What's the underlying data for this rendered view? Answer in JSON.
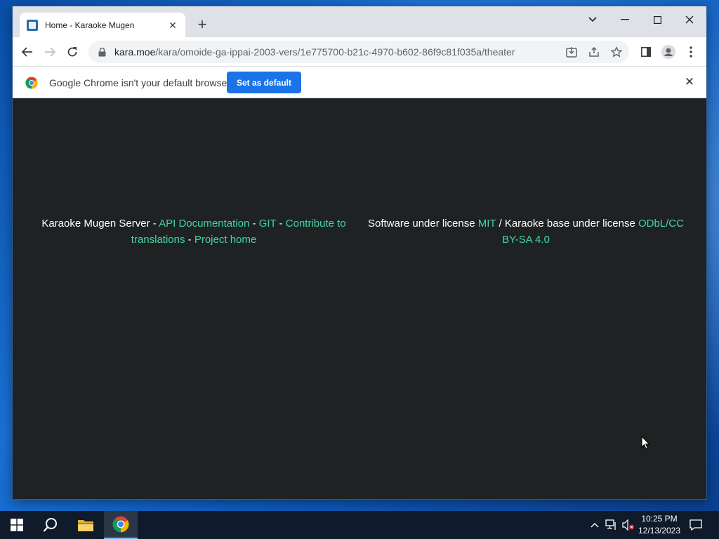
{
  "browser": {
    "tab": {
      "title": "Home - Karaoke Mugen"
    },
    "address_bar": {
      "host": "kara.moe",
      "path": "/kara/omoide-ga-ippai-2003-vers/1e775700-b21c-4970-b602-86f9c81f035a/theater"
    },
    "infobar": {
      "message": "Google Chrome isn't your default browser",
      "button_label": "Set as default"
    }
  },
  "page": {
    "left_footer": {
      "prefix": "Karaoke Mugen Server - ",
      "link_api": "API Documentation",
      "sep1": " - ",
      "link_git": "GIT",
      "sep2": " - ",
      "link_contribute": "Contribute to translations",
      "sep3": " - ",
      "link_project": "Project home"
    },
    "right_footer": {
      "prefix": "Software under license ",
      "link_mit": "MIT",
      "middle": " / Karaoke base under license ",
      "link_odbl": "ODbL/CC BY-SA 4.0"
    },
    "link_color": "#42d6a4",
    "background_color": "#1f2223"
  },
  "taskbar": {
    "clock_time": "10:25 PM",
    "clock_date": "12/13/2023"
  }
}
